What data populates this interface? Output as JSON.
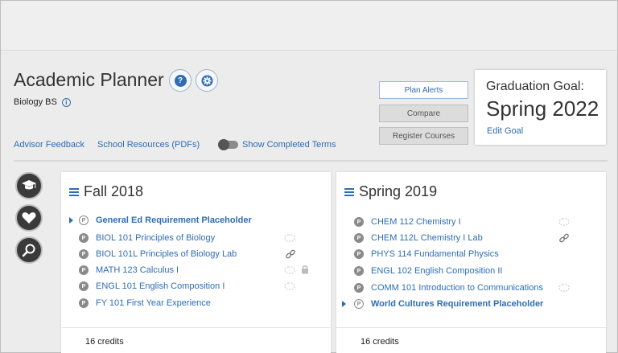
{
  "page": {
    "title": "Academic Planner",
    "subtitle": "Biology BS",
    "links": {
      "advisor": "Advisor Feedback",
      "resources": "School Resources (PDFs)",
      "show_completed": "Show Completed Terms"
    },
    "actions": {
      "plan_alerts": "Plan Alerts",
      "compare": "Compare",
      "register": "Register Courses"
    },
    "goal": {
      "label": "Graduation Goal:",
      "value": "Spring 2022",
      "edit": "Edit Goal"
    }
  },
  "icons": {
    "help": "help-icon",
    "settings": "gear-icon",
    "info": "info-icon",
    "graduation": "graduation-cap-icon",
    "favorites": "heart-icon",
    "search": "search-icon",
    "link": "link-icon",
    "lock": "lock-icon",
    "swap": "swap-icon"
  },
  "colors": {
    "accent": "#2e6db4",
    "badge": "#8a8a8a",
    "sidebar_icon": "#3a3a3a"
  },
  "terms": [
    {
      "name": "Fall 2018",
      "credits": "16 credits",
      "courses": [
        {
          "code_title": "General Ed Requirement Placeholder",
          "badge": "P",
          "placeholder": true
        },
        {
          "code_title": "BIOL 101 Principles of Biology",
          "badge": "P"
        },
        {
          "code_title": "BIOL 101L Principles of Biology Lab",
          "badge": "P"
        },
        {
          "code_title": "MATH 123 Calculus I",
          "badge": "P"
        },
        {
          "code_title": "ENGL 101 English Composition I",
          "badge": "P"
        },
        {
          "code_title": "FY 101 First Year Experience",
          "badge": "P"
        }
      ]
    },
    {
      "name": "Spring 2019",
      "credits": "16 credits",
      "courses": [
        {
          "code_title": "CHEM 112 Chemistry I",
          "badge": "P"
        },
        {
          "code_title": "CHEM 112L Chemistry I Lab",
          "badge": "P"
        },
        {
          "code_title": "PHYS 114 Fundamental Physics",
          "badge": "P"
        },
        {
          "code_title": "ENGL 102 English Composition II",
          "badge": "P"
        },
        {
          "code_title": "COMM 101 Introduction to Communications",
          "badge": "P"
        },
        {
          "code_title": "World Cultures Requirement Placeholder",
          "badge": "P",
          "placeholder": true
        }
      ]
    }
  ]
}
